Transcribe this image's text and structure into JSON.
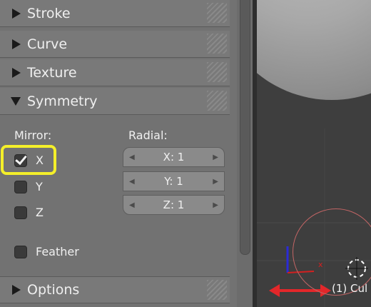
{
  "panels": {
    "stroke": "Stroke",
    "curve": "Curve",
    "texture": "Texture",
    "symmetry": "Symmetry",
    "options": "Options"
  },
  "symmetry": {
    "mirror_label": "Mirror:",
    "radial_label": "Radial:",
    "mirror_x": "X",
    "mirror_y": "Y",
    "mirror_z": "Z",
    "feather": "Feather",
    "radial_x": "X: 1",
    "radial_y": "Y: 1",
    "radial_z": "Z: 1"
  },
  "viewport": {
    "object_label": "(1) Cul",
    "axis_x_marker": "x"
  },
  "colors": {
    "highlight": "#f4ef2a",
    "axis_x": "#d42020",
    "axis_z": "#2b2bd6"
  }
}
